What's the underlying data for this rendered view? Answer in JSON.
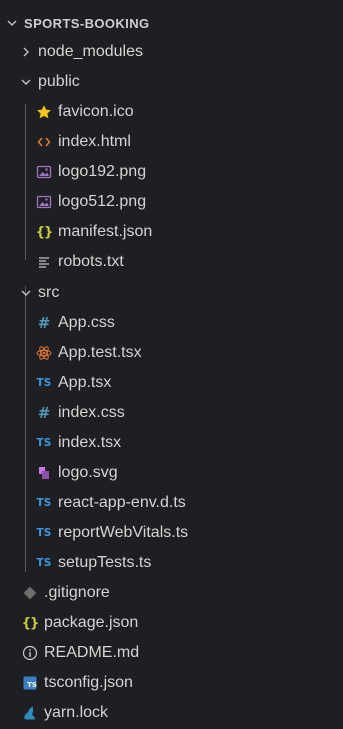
{
  "explorer": {
    "root_label": "SPORTS-BOOKING",
    "items": [
      {
        "label": "node_modules",
        "icon": "chevron-right",
        "type": "folder"
      },
      {
        "label": "public",
        "icon": "chevron-down",
        "type": "folder"
      },
      {
        "label": "favicon.ico",
        "icon": "star-icon",
        "type": "file"
      },
      {
        "label": "index.html",
        "icon": "html-icon",
        "type": "file"
      },
      {
        "label": "logo192.png",
        "icon": "image-icon",
        "type": "file"
      },
      {
        "label": "logo512.png",
        "icon": "image-icon",
        "type": "file"
      },
      {
        "label": "manifest.json",
        "icon": "json-icon",
        "type": "file"
      },
      {
        "label": "robots.txt",
        "icon": "text-file-icon",
        "type": "file"
      },
      {
        "label": "src",
        "icon": "chevron-down",
        "type": "folder"
      },
      {
        "label": "App.css",
        "icon": "css-hash-icon",
        "type": "file"
      },
      {
        "label": "App.test.tsx",
        "icon": "react-test-icon",
        "type": "file"
      },
      {
        "label": "App.tsx",
        "icon": "typescript-icon",
        "type": "file"
      },
      {
        "label": "index.css",
        "icon": "css-hash-icon",
        "type": "file"
      },
      {
        "label": "index.tsx",
        "icon": "typescript-icon",
        "type": "file"
      },
      {
        "label": "logo.svg",
        "icon": "svg-icon",
        "type": "file"
      },
      {
        "label": "react-app-env.d.ts",
        "icon": "typescript-icon",
        "type": "file"
      },
      {
        "label": "reportWebVitals.ts",
        "icon": "typescript-icon",
        "type": "file"
      },
      {
        "label": "setupTests.ts",
        "icon": "typescript-icon",
        "type": "file"
      },
      {
        "label": ".gitignore",
        "icon": "git-icon",
        "type": "file"
      },
      {
        "label": "package.json",
        "icon": "json-icon",
        "type": "file"
      },
      {
        "label": "README.md",
        "icon": "info-icon",
        "type": "file"
      },
      {
        "label": "tsconfig.json",
        "icon": "tsconfig-icon",
        "type": "file"
      },
      {
        "label": "yarn.lock",
        "icon": "yarn-icon",
        "type": "file"
      }
    ],
    "badges": {
      "typescript": "TS",
      "tsconfig": "TS",
      "json": "{}",
      "css": "#",
      "html": "<>"
    },
    "colors": {
      "background": "#1e1f22",
      "text": "#d4d4d4",
      "typescript": "#3a96dd",
      "json": "#cbcb41",
      "css": "#519aba",
      "html": "#e37933",
      "image": "#a074c4",
      "star": "#f5c518",
      "svg": "#c678dd",
      "git": "#6d6d6d",
      "react": "#e37933"
    }
  }
}
